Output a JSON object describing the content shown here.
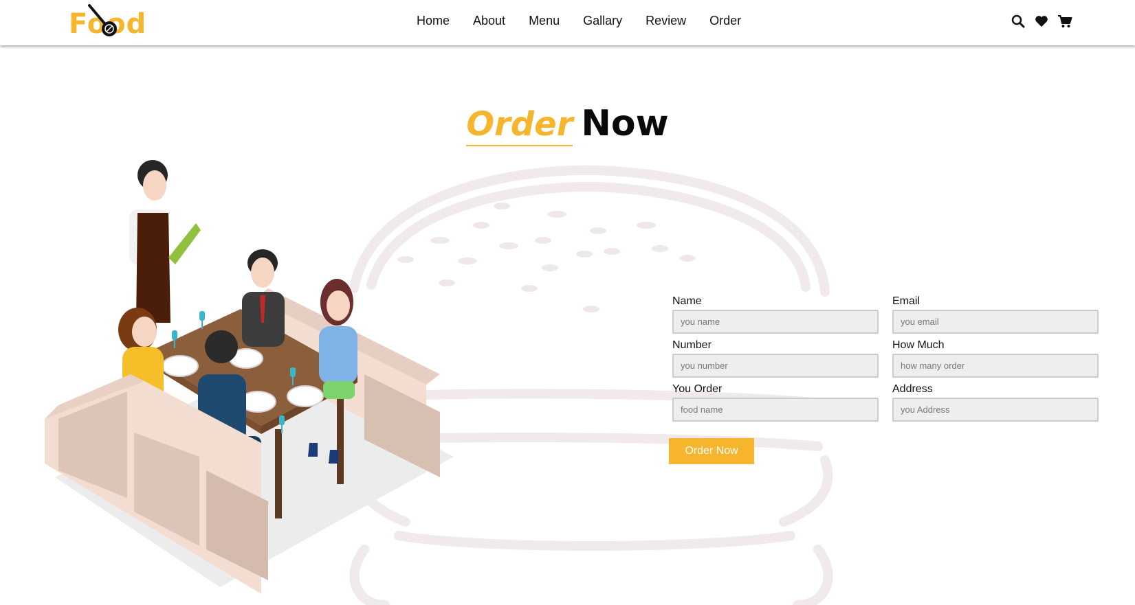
{
  "brand": {
    "logo_text": "Food",
    "accent_color": "#f7b52d"
  },
  "nav": {
    "links": [
      "Home",
      "About",
      "Menu",
      "Gallary",
      "Review",
      "Order"
    ]
  },
  "header_icons": [
    "search-icon",
    "heart-icon",
    "cart-icon"
  ],
  "section": {
    "title_accent": "Order",
    "title_main": "Now"
  },
  "form": {
    "fields": [
      {
        "label": "Name",
        "placeholder": "you name"
      },
      {
        "label": "Email",
        "placeholder": "you email"
      },
      {
        "label": "Number",
        "placeholder": "you number"
      },
      {
        "label": "How Much",
        "placeholder": "how many order"
      },
      {
        "label": "You Order",
        "placeholder": "food name"
      },
      {
        "label": "Address",
        "placeholder": "you Address"
      }
    ],
    "submit_label": "Order Now"
  }
}
